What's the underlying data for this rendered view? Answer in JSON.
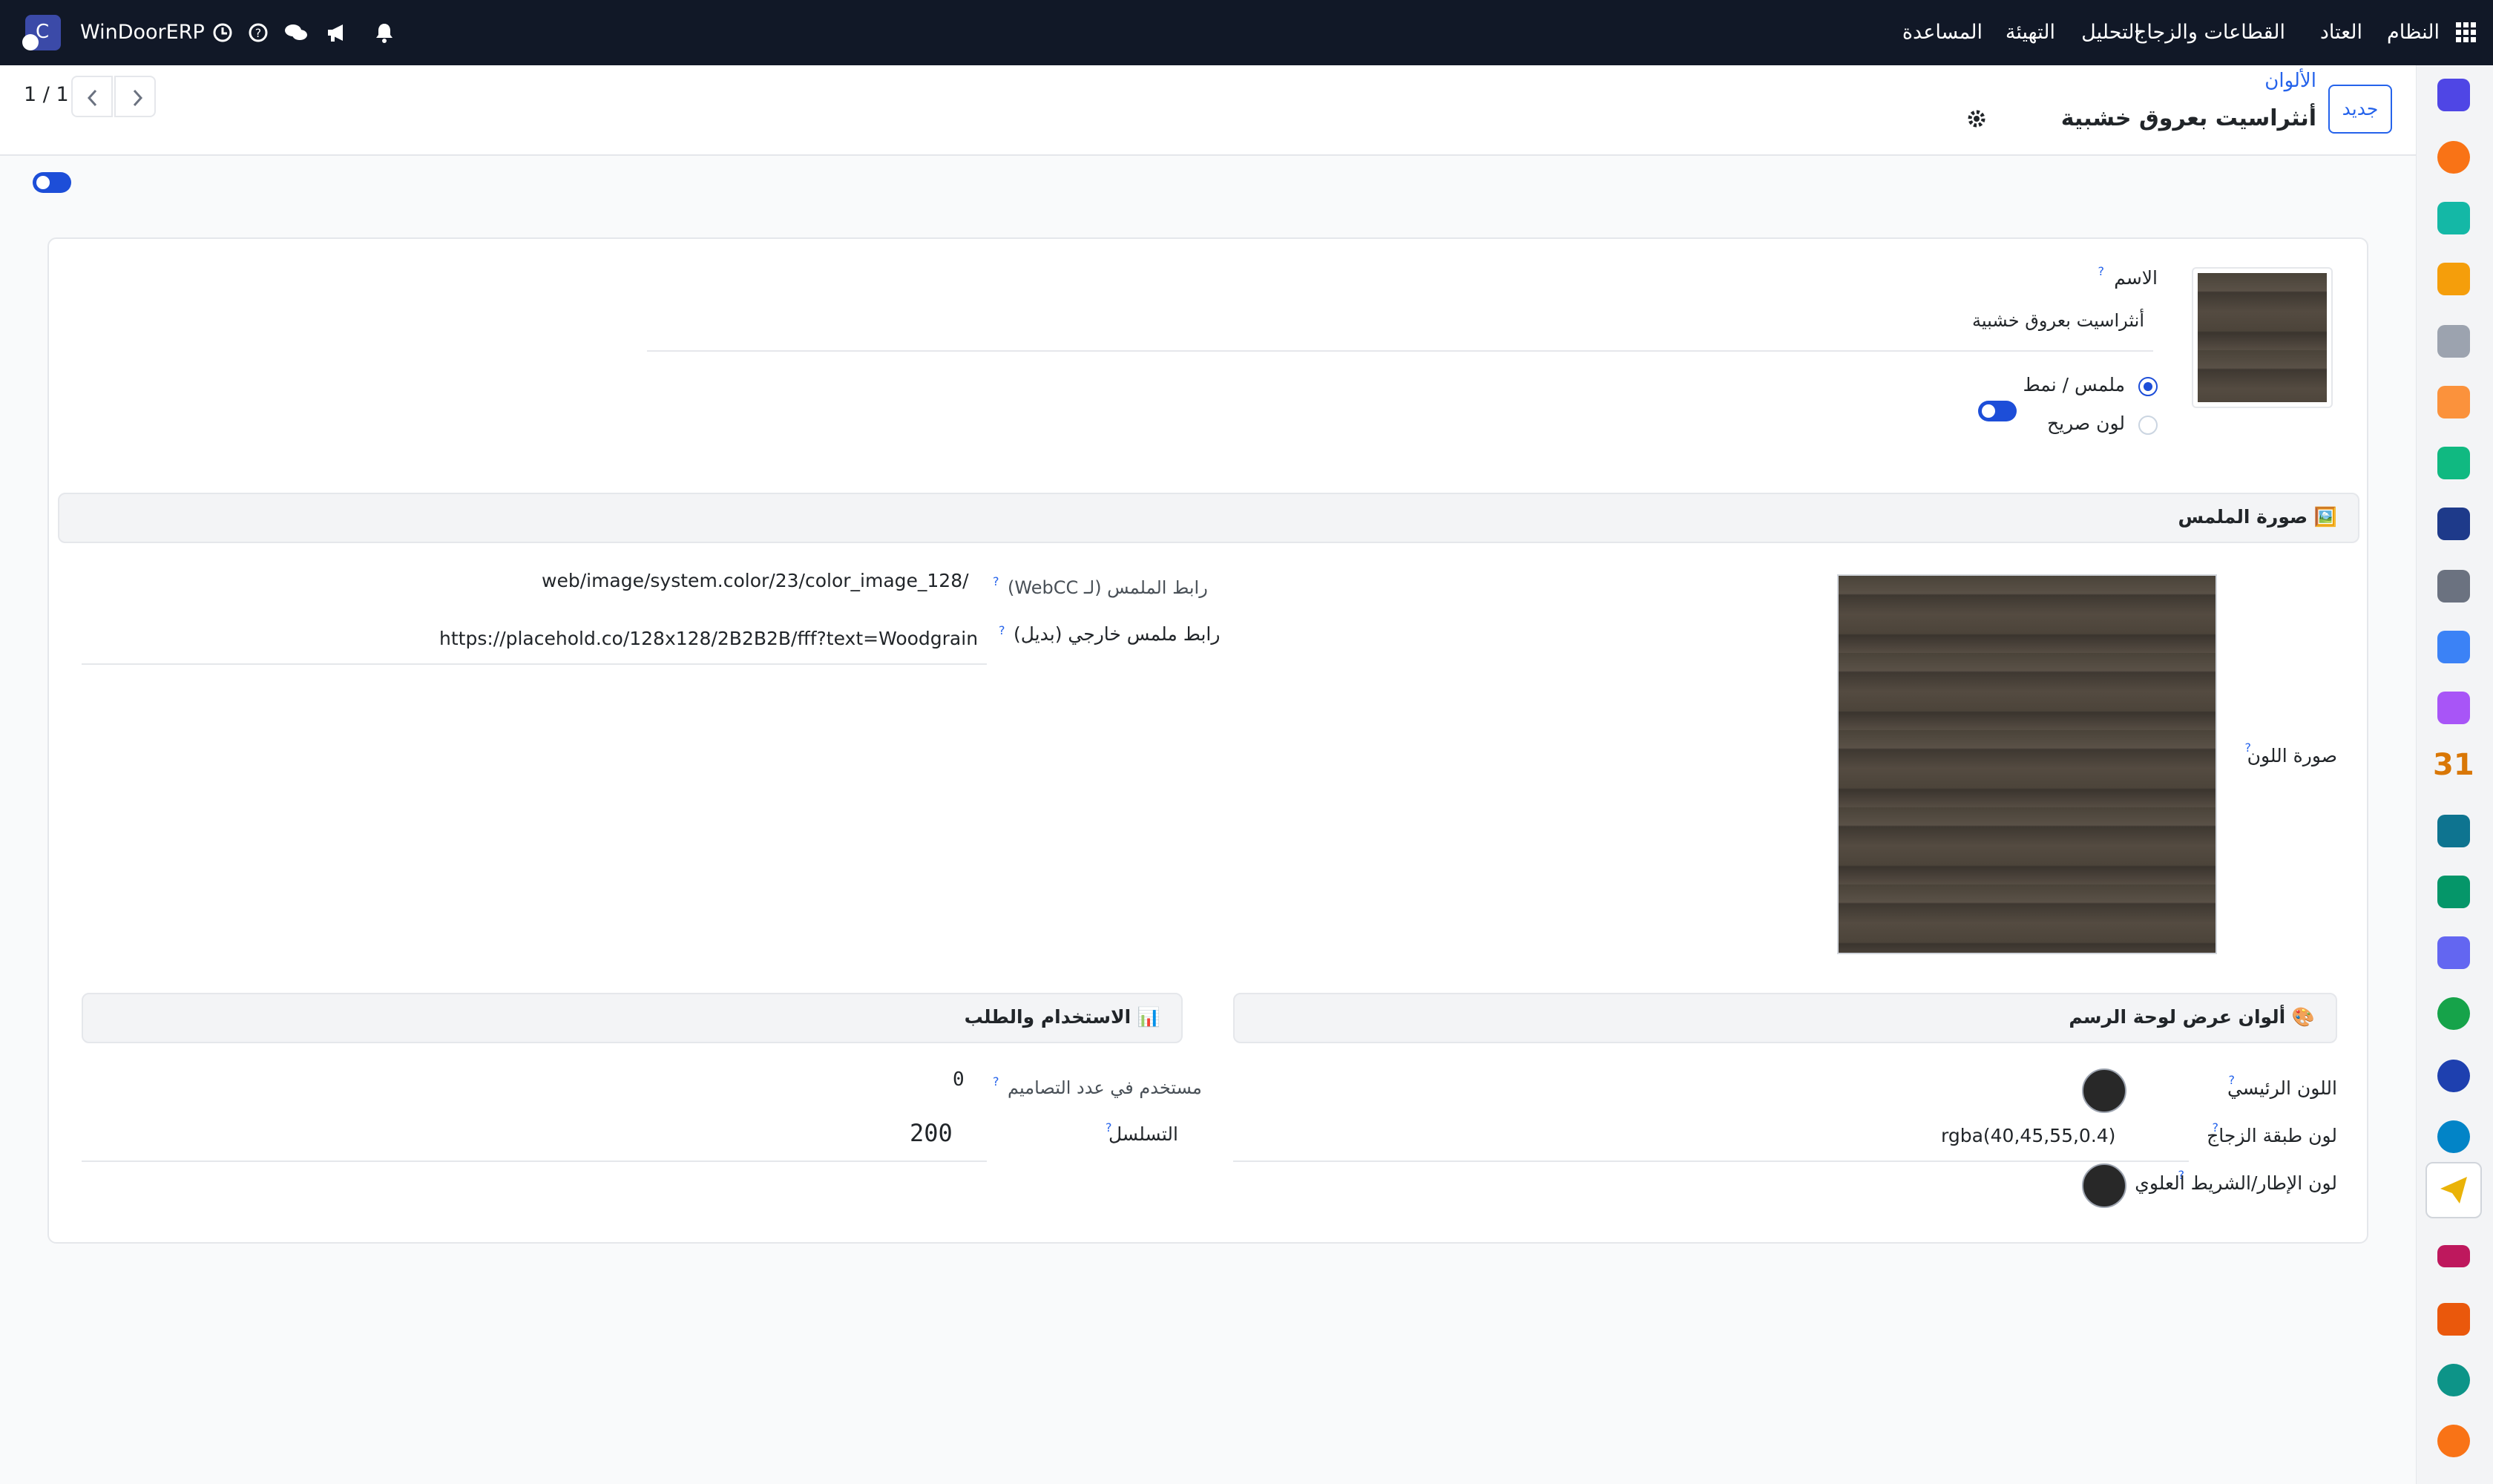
{
  "topbar": {
    "menu": [
      "النظام",
      "العتاد",
      "القطاعات والزجاج",
      "التحليل",
      "التهيئة",
      "المساعدة"
    ],
    "company": "WinDoorERP",
    "logo_letter": "C"
  },
  "control_panel": {
    "breadcrumb_parent": "الألوان",
    "record_title": "أنثراسيت بعروق خشبية",
    "new_button": "جديد",
    "pager": "1 / 1"
  },
  "form": {
    "name_label": "الاسم",
    "name_value": "أنثراسيت بعروق خشبية",
    "option_texture": "ملمس / نمط",
    "option_solid": "لون صريح",
    "texture_section_title": "🖼️ صورة الملمس",
    "color_image_label": "صورة اللون",
    "texture_url_label": "رابط الملمس (لـ WebCC)",
    "texture_url_value": "/web/image/system.color/23/color_image_128",
    "external_url_label": "رابط ملمس خارجي (بديل)",
    "external_url_value": "https://placehold.co/128x128/2B2B2B/fff?text=Woodgrain",
    "canvas_section_title": "🎨 ألوان عرض لوحة الرسم",
    "main_color_label": "اللون الرئيسي",
    "glass_color_label": "لون طبقة الزجاج",
    "glass_color_value": "rgba(40,45,55,0.4)",
    "frame_color_label": "لون الإطار/الشريط العلوي",
    "usage_section_title": "📊 الاستخدام والطلب",
    "used_in_label": "مستخدم في عدد التصاميم",
    "used_in_value": "0",
    "sequence_label": "التسلسل",
    "sequence_value": "200",
    "help_mark": "?"
  },
  "colors": {
    "topbar_bg": "#111827",
    "accent": "#1d4ed8",
    "main_color": "#282828",
    "frame_color": "#282828"
  }
}
